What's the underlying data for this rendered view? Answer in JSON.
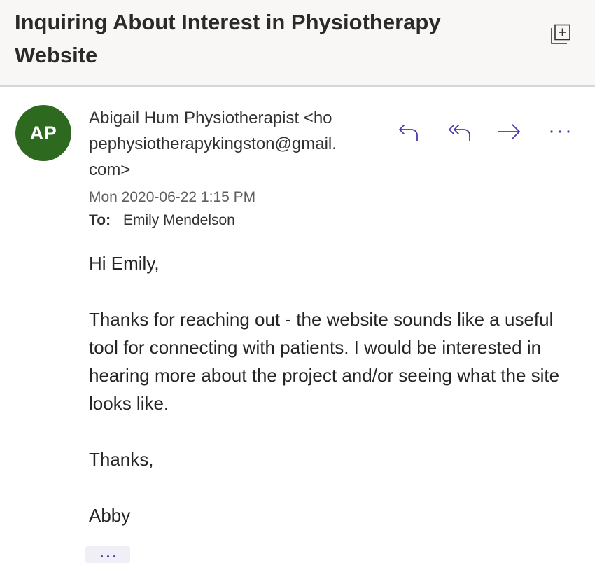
{
  "email": {
    "subject": "Inquiring About Interest in Physiotherapy Website",
    "sender": {
      "initials": "AP",
      "avatar_color": "#2d6a20",
      "display": "Abigail Hum Physiotherapist <hopephysiotherapykingston@gmail.com>"
    },
    "date": "Mon 2020-06-22 1:15 PM",
    "to_label": "To:",
    "to_value": "Emily Mendelson",
    "body": {
      "greeting": "Hi Emily,",
      "paragraph": "Thanks for reaching out - the website sounds like a useful tool for connecting with patients. I would be interested in hearing more about the project and/or seeing what the site looks like.",
      "closing": "Thanks,",
      "signature": "Abby"
    }
  },
  "icons": {
    "popout": "open-in-new-window-icon",
    "reply": "reply-icon",
    "reply_all": "reply-all-icon",
    "forward": "forward-icon",
    "more": "more-actions-icon",
    "expand": "show-trimmed-content-icon"
  },
  "colors": {
    "accent": "#4a3aa8",
    "header_bg": "#f8f7f6",
    "avatar": "#2d6a20"
  }
}
